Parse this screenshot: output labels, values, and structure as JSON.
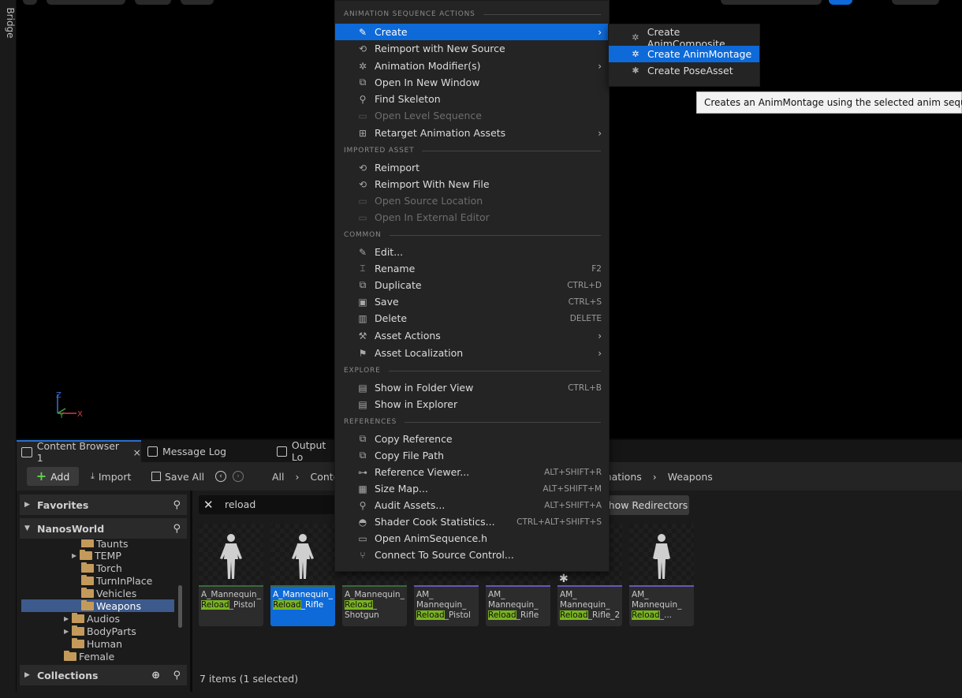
{
  "bridge_label": "Bridge",
  "tabs": [
    {
      "label": "Content Browser 1",
      "close": "×"
    },
    {
      "label": "Message Log"
    },
    {
      "label": "Output Lo"
    }
  ],
  "toolbar": {
    "add": "Add",
    "import": "Import",
    "save_all": "Save All",
    "path": [
      "All",
      "Conte"
    ],
    "path_tail": [
      "imations",
      "Weapons"
    ]
  },
  "sidebar": {
    "favorites": "Favorites",
    "root": "NanosWorld",
    "collections": "Collections",
    "tree": [
      "Taunts",
      "TEMP",
      "Torch",
      "TurnInPlace",
      "Vehicles",
      "Weapons",
      "Audios",
      "BodyParts",
      "Human",
      "Female"
    ]
  },
  "search": {
    "value": "reload"
  },
  "show_redirectors": "Show Redirectors",
  "assets": [
    {
      "l1": "A_Mannequin_",
      "hl": "Reload",
      "tail": "_Pistol"
    },
    {
      "l1": "A_Mannequin_",
      "hl": "Reload",
      "tail": "_Rifle"
    },
    {
      "l1": "A_Mannequin_",
      "hl": "Reload",
      "tail": "_",
      "l3": "Shotgun"
    },
    {
      "l1": "AM_",
      "l2": "Mannequin_",
      "hl": "Reload",
      "tail": "_Pistol"
    },
    {
      "l1": "AM_",
      "l2": "Mannequin_",
      "hl": "Reload",
      "tail": "_Rifle"
    },
    {
      "l1": "AM_",
      "l2": "Mannequin_",
      "hl": "Reload",
      "tail": "_Rifle_2"
    },
    {
      "l1": "AM_",
      "l2": "Mannequin_",
      "hl": "Reload",
      "tail": "_..."
    }
  ],
  "status": "7 items (1 selected)",
  "menu": {
    "headers": [
      "ANIMATION SEQUENCE ACTIONS",
      "IMPORTED ASSET",
      "COMMON",
      "EXPLORE",
      "REFERENCES"
    ],
    "anim": [
      {
        "label": "Create"
      },
      {
        "label": "Reimport with New Source"
      },
      {
        "label": "Animation Modifier(s)"
      },
      {
        "label": "Open In New Window"
      },
      {
        "label": "Find Skeleton"
      },
      {
        "label": "Open Level Sequence"
      },
      {
        "label": "Retarget Animation Assets"
      }
    ],
    "imported": [
      {
        "label": "Reimport"
      },
      {
        "label": "Reimport With New File"
      },
      {
        "label": "Open Source Location"
      },
      {
        "label": "Open In External Editor"
      }
    ],
    "common": [
      {
        "label": "Edit...",
        "sc": ""
      },
      {
        "label": "Rename",
        "sc": "F2"
      },
      {
        "label": "Duplicate",
        "sc": "CTRL+D"
      },
      {
        "label": "Save",
        "sc": "CTRL+S"
      },
      {
        "label": "Delete",
        "sc": "DELETE"
      },
      {
        "label": "Asset Actions",
        "sc": ""
      },
      {
        "label": "Asset Localization",
        "sc": ""
      }
    ],
    "explore": [
      {
        "label": "Show in Folder View",
        "sc": "CTRL+B"
      },
      {
        "label": "Show in Explorer",
        "sc": ""
      }
    ],
    "references": [
      {
        "label": "Copy Reference",
        "sc": ""
      },
      {
        "label": "Copy File Path",
        "sc": ""
      },
      {
        "label": "Reference Viewer...",
        "sc": "ALT+SHIFT+R"
      },
      {
        "label": "Size Map...",
        "sc": "ALT+SHIFT+M"
      },
      {
        "label": "Audit Assets...",
        "sc": "ALT+SHIFT+A"
      },
      {
        "label": "Shader Cook Statistics...",
        "sc": "CTRL+ALT+SHIFT+S"
      },
      {
        "label": "Open AnimSequence.h",
        "sc": ""
      },
      {
        "label": "Connect To Source Control...",
        "sc": ""
      }
    ]
  },
  "submenu": [
    "Create AnimComposite",
    "Create AnimMontage",
    "Create PoseAsset"
  ],
  "tooltip": "Creates an AnimMontage using the selected anim sequence.",
  "gizmo": {
    "z": "Z",
    "y": "Y",
    "x": "X"
  }
}
